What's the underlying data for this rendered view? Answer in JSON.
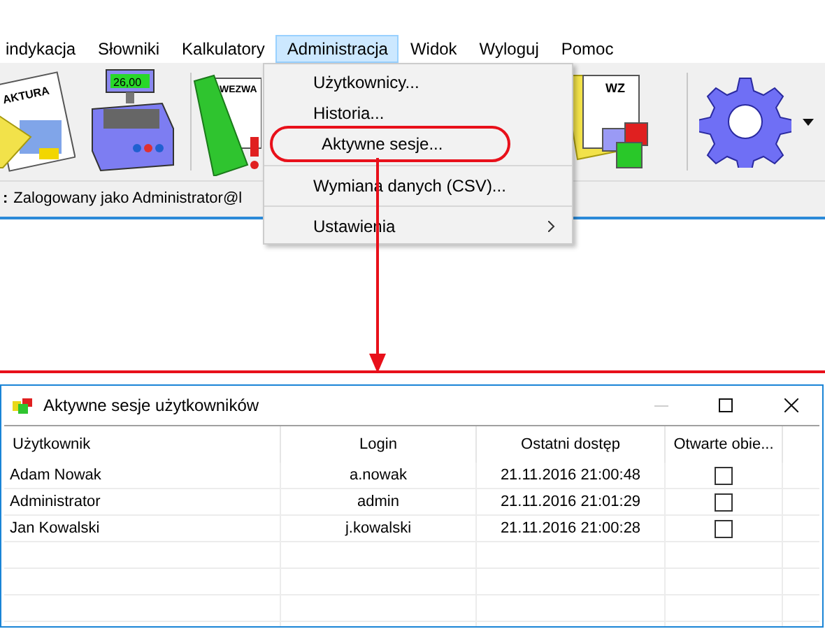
{
  "menu_bar": [
    {
      "label": "indykacja",
      "selected": false
    },
    {
      "label": "Słowniki",
      "selected": false
    },
    {
      "label": "Kalkulatory",
      "selected": false
    },
    {
      "label": "Administracja",
      "selected": true
    },
    {
      "label": "Widok",
      "selected": false
    },
    {
      "label": "Wyloguj",
      "selected": false
    },
    {
      "label": "Pomoc",
      "selected": false
    }
  ],
  "toolbar": {
    "register_display": "26,00",
    "invoice_label": "AKTURA",
    "reminder_label": "WEZWA",
    "wz_label": "WZ"
  },
  "status": {
    "label": ":",
    "text": "Zalogowany jako Administrator@l"
  },
  "dropdown": {
    "items": [
      {
        "label": "Użytkownicy...",
        "separator_before": false,
        "submenu": false,
        "annotated": false
      },
      {
        "label": "Historia...",
        "separator_before": false,
        "submenu": false,
        "annotated": false
      },
      {
        "label": "Aktywne sesje...",
        "separator_before": false,
        "submenu": false,
        "annotated": true
      },
      {
        "label": "Wymiana danych (CSV)...",
        "separator_before": true,
        "submenu": false,
        "annotated": false
      },
      {
        "label": "Ustawienia",
        "separator_before": true,
        "submenu": true,
        "annotated": false
      }
    ]
  },
  "dialog": {
    "title": "Aktywne sesje użytkowników",
    "table": {
      "columns": [
        "Użytkownik",
        "Login",
        "Ostatni dostęp",
        "Otwarte obie..."
      ],
      "rows": [
        {
          "user": "Adam Nowak",
          "login": "a.nowak",
          "last_access": "21.11.2016 21:00:48",
          "open": {
            "checked": false
          }
        },
        {
          "user": "Administrator",
          "login": "admin",
          "last_access": "21.11.2016 21:01:29",
          "open": {
            "checked": false
          }
        },
        {
          "user": "Jan Kowalski",
          "login": "j.kowalski",
          "last_access": "21.11.2016 21:00:28",
          "open": {
            "checked": false
          }
        }
      ]
    }
  }
}
